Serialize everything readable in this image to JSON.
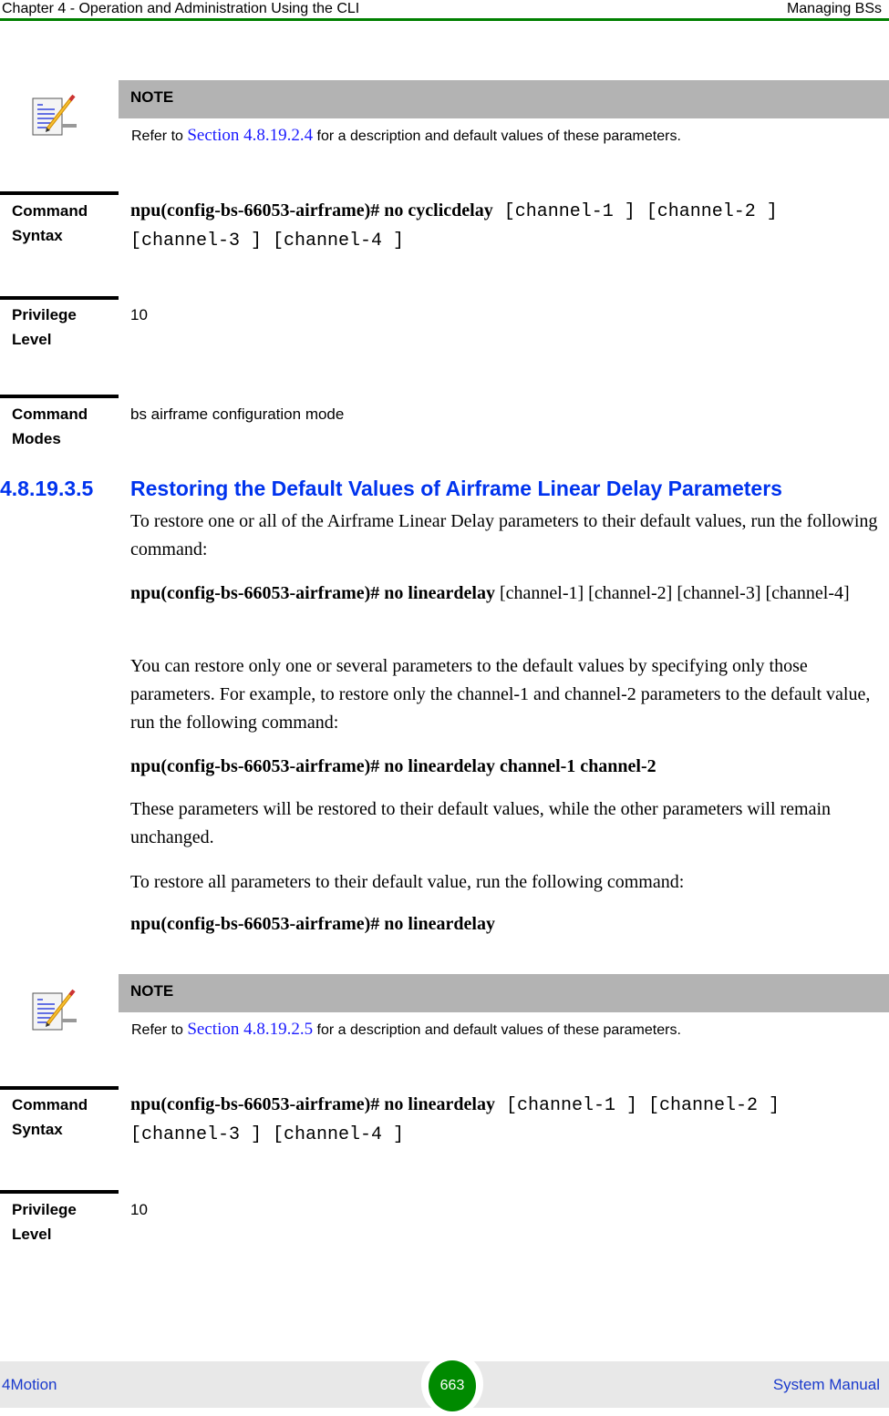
{
  "header": {
    "chapter_title": "Chapter 4 - Operation and Administration Using the CLI",
    "section_title": "Managing BSs",
    "rule_color": "#008000"
  },
  "notes": [
    {
      "icon": "note-pencil-icon",
      "title": "NOTE",
      "text_before": "Refer to ",
      "link": "Section 4.8.19.2.4",
      "text_after": " for a description and default values of these parameters."
    },
    {
      "icon": "note-pencil-icon",
      "title": "NOTE",
      "text_before": "Refer to ",
      "link": "Section 4.8.19.2.5",
      "text_after": " for a description and default values of these parameters."
    }
  ],
  "cyclicdelay_fields": {
    "syntax": {
      "label_line1": "Command",
      "label_line2": "Syntax",
      "command": "npu(config-bs-66053-airframe)# no cyclicdelay",
      "args": " [channel-1 ] [channel-2 ] [channel-3 ] [channel-4 ]"
    },
    "privilege": {
      "label_line1": "Privilege",
      "label_line2": "Level",
      "value": "10"
    },
    "modes": {
      "label_line1": "Command",
      "label_line2": "Modes",
      "value": "bs airframe configuration mode"
    }
  },
  "section": {
    "number": "4.8.19.3.5",
    "title": "Restoring the Default Values of Airframe Linear Delay Parameters",
    "color": "#0033ee",
    "paragraphs": {
      "intro": "To restore one or all of the Airframe Linear Delay parameters to their default values, run the following command:",
      "cmd1_bold": "npu(config-bs-66053-airframe)# no lineardelay",
      "cmd1_args": " [channel-1] [channel-2] [channel-3] [channel-4]",
      "explain": "You can restore only one or several parameters to the default values by specifying only those parameters. For example, to restore only the channel-1 and channel-2 parameters to the default value, run the following command:",
      "cmd2": "npu(config-bs-66053-airframe)# no lineardelay channel-1 channel-2",
      "result": "These parameters will be restored to their default values, while the other parameters will remain unchanged.",
      "all_intro": "To restore all parameters to their default value, run the following command:",
      "cmd3": "npu(config-bs-66053-airframe)# no lineardelay"
    }
  },
  "lineardelay_fields": {
    "syntax": {
      "label_line1": "Command",
      "label_line2": "Syntax",
      "command": "npu(config-bs-66053-airframe)# no lineardelay",
      "args": " [channel-1 ] [channel-2 ] [channel-3 ] [channel-4 ]"
    },
    "privilege": {
      "label_line1": "Privilege",
      "label_line2": "Level",
      "value": "10"
    }
  },
  "footer": {
    "product": "4Motion",
    "page_number": "663",
    "manual": "System Manual",
    "badge_color": "#008a00"
  }
}
